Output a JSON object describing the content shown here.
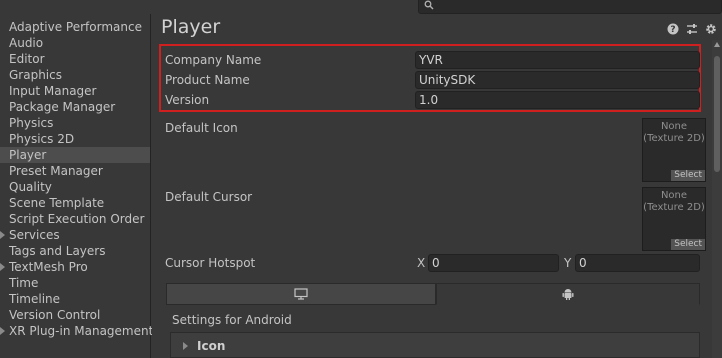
{
  "search": {
    "icon": "search-icon"
  },
  "sidebar": {
    "items": [
      {
        "label": "Adaptive Performance"
      },
      {
        "label": "Audio"
      },
      {
        "label": "Editor"
      },
      {
        "label": "Graphics"
      },
      {
        "label": "Input Manager"
      },
      {
        "label": "Package Manager"
      },
      {
        "label": "Physics"
      },
      {
        "label": "Physics 2D"
      },
      {
        "label": "Player",
        "selected": true
      },
      {
        "label": "Preset Manager"
      },
      {
        "label": "Quality"
      },
      {
        "label": "Scene Template"
      },
      {
        "label": "Script Execution Order"
      },
      {
        "label": "Services",
        "foldout": true
      },
      {
        "label": "Tags and Layers"
      },
      {
        "label": "TextMesh Pro",
        "foldout": true
      },
      {
        "label": "Time"
      },
      {
        "label": "Timeline"
      },
      {
        "label": "Version Control"
      },
      {
        "label": "XR Plug-in Management",
        "foldout": true
      }
    ]
  },
  "header": {
    "title": "Player",
    "icons": [
      "help-icon",
      "preset-icon",
      "settings-icon"
    ]
  },
  "fields": {
    "company_name": {
      "label": "Company Name",
      "value": "YVR"
    },
    "product_name": {
      "label": "Product Name",
      "value": "UnitySDK"
    },
    "version": {
      "label": "Version",
      "value": "1.0"
    }
  },
  "default_icon": {
    "label": "Default Icon",
    "none_text": "None\n(Texture 2D)",
    "select_label": "Select"
  },
  "default_cursor": {
    "label": "Default Cursor",
    "none_text": "None\n(Texture 2D)",
    "select_label": "Select"
  },
  "cursor_hotspot": {
    "label": "Cursor Hotspot",
    "x_label": "X",
    "x_value": "0",
    "y_label": "Y",
    "y_value": "0"
  },
  "platform_tabs": [
    {
      "name": "standalone",
      "icon": "monitor-icon",
      "active": false
    },
    {
      "name": "android",
      "icon": "android-icon",
      "active": true
    }
  ],
  "settings_for": "Settings for Android",
  "sections": {
    "icon": "Icon"
  },
  "colors": {
    "highlight": "#d01f1f",
    "selected_row": "#4d4d4d",
    "background": "#383838"
  }
}
